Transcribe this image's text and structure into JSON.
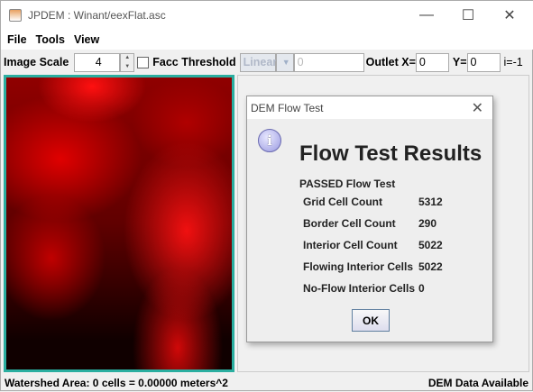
{
  "window": {
    "title": "JPDEM : Winant/eexFlat.asc",
    "minimize": "—",
    "maximize": "☐",
    "close": "✕"
  },
  "menu": [
    "File",
    "Tools",
    "View"
  ],
  "toolbar": {
    "image_scale_label": "Image Scale",
    "image_scale_value": "4",
    "facc_label": "Facc Threshold",
    "facc_checked": false,
    "scale_type": "Linear",
    "threshold_value": "0",
    "outlet_x_label": "Outlet X=",
    "outlet_x": "0",
    "y_label": "Y=",
    "outlet_y": "0",
    "i_label": "i=",
    "i_value": "-1"
  },
  "status": {
    "left": "Watershed Area: 0 cells = 0.00000 meters^2",
    "right": "DEM Data Available"
  },
  "dialog": {
    "title": "DEM Flow Test",
    "heading": "Flow Test Results",
    "passed": "PASSED Flow Test",
    "rows": [
      {
        "label": "Grid Cell Count",
        "value": "5312"
      },
      {
        "label": "Border Cell Count",
        "value": "290"
      },
      {
        "label": "Interior Cell Count",
        "value": "5022"
      },
      {
        "label": "Flowing Interior Cells",
        "value": "5022"
      },
      {
        "label": "No-Flow Interior Cells",
        "value": "0"
      }
    ],
    "ok": "OK"
  }
}
